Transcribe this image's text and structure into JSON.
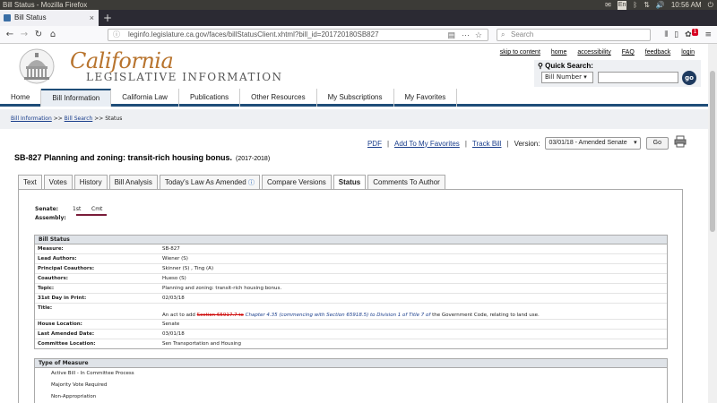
{
  "os": {
    "window_title": "Bill Status - Mozilla Firefox",
    "keyboard": "En",
    "volume_icon": "speaker-icon",
    "clock": "10:56 AM"
  },
  "browser": {
    "tab_title": "Bill Status",
    "tab_close": "×",
    "new_tab": "+",
    "url": "leginfo.legislature.ca.gov/faces/billStatusClient.xhtml?bill_id=201720180SB827",
    "search_placeholder": "Search",
    "menu_badge": "1"
  },
  "site": {
    "logo_script": "California",
    "logo_caps": "LEGISLATIVE INFORMATION",
    "top_links": [
      "skip to content",
      "home",
      "accessibility",
      "FAQ",
      "feedback",
      "login"
    ],
    "quick_search_label": "Quick Search:",
    "quick_search_select": "Bill Number",
    "quick_search_go": "go",
    "nav": [
      "Home",
      "Bill Information",
      "California Law",
      "Publications",
      "Other Resources",
      "My Subscriptions",
      "My Favorites"
    ],
    "nav_active": "Bill Information",
    "breadcrumb": [
      "Bill Information",
      "Bill Search",
      "Status"
    ],
    "crumb_sep": ">>"
  },
  "actions": {
    "pdf": "PDF",
    "favorites": "Add To My Favorites",
    "track": "Track Bill",
    "version_label": "Version:",
    "version_value": "03/01/18 - Amended Senate",
    "go": "Go",
    "sep": "|"
  },
  "bill": {
    "title": "SB-827 Planning and zoning: transit-rich housing bonus.",
    "session": "(2017-2018)"
  },
  "tabs": [
    "Text",
    "Votes",
    "History",
    "Bill Analysis",
    "Today's Law As Amended",
    "Compare Versions",
    "Status",
    "Comments To Author"
  ],
  "tabs_active": "Status",
  "progress": {
    "senate_label": "Senate:",
    "assembly_label": "Assembly:",
    "senate_steps": [
      "1st",
      "Cmt"
    ]
  },
  "status": {
    "header": "Bill Status",
    "rows": [
      {
        "k": "Measure:",
        "v": "SB-827"
      },
      {
        "k": "Lead Authors:",
        "v": "Wiener (S)"
      },
      {
        "k": "Principal Coauthors:",
        "v": "Skinner (S) , Ting (A)"
      },
      {
        "k": "Coauthors:",
        "v": "Hueso (S)"
      },
      {
        "k": "Topic:",
        "v": "Planning and zoning: transit-rich housing bonus."
      },
      {
        "k": "31st Day in Print:",
        "v": "02/03/18"
      }
    ],
    "title_label": "Title:",
    "title_pre": "An act to add ",
    "title_strike": "Section 65917.7 to",
    "title_ins": "Chapter 4.35 (commencing with Section 65918.5) to Division 1 of Title 7 of",
    "title_post": " the Government Code, relating to land use.",
    "rows2": [
      {
        "k": "House Location:",
        "v": "Senate"
      },
      {
        "k": "Last Amended Date:",
        "v": "03/01/18"
      },
      {
        "k": "Committee Location:",
        "v": "Sen Transportation and Housing"
      }
    ]
  },
  "measure": {
    "header": "Type of Measure",
    "items": [
      "Active Bill - In Committee Process",
      "Majority Vote Required",
      "Non-Appropriation"
    ]
  },
  "colors": {
    "brand_gold": "#b8742e",
    "nav_blue": "#1e4d78",
    "link_blue": "#1a3e8c",
    "progress": "#7a1d3a",
    "strike_red": "#cc0000"
  }
}
